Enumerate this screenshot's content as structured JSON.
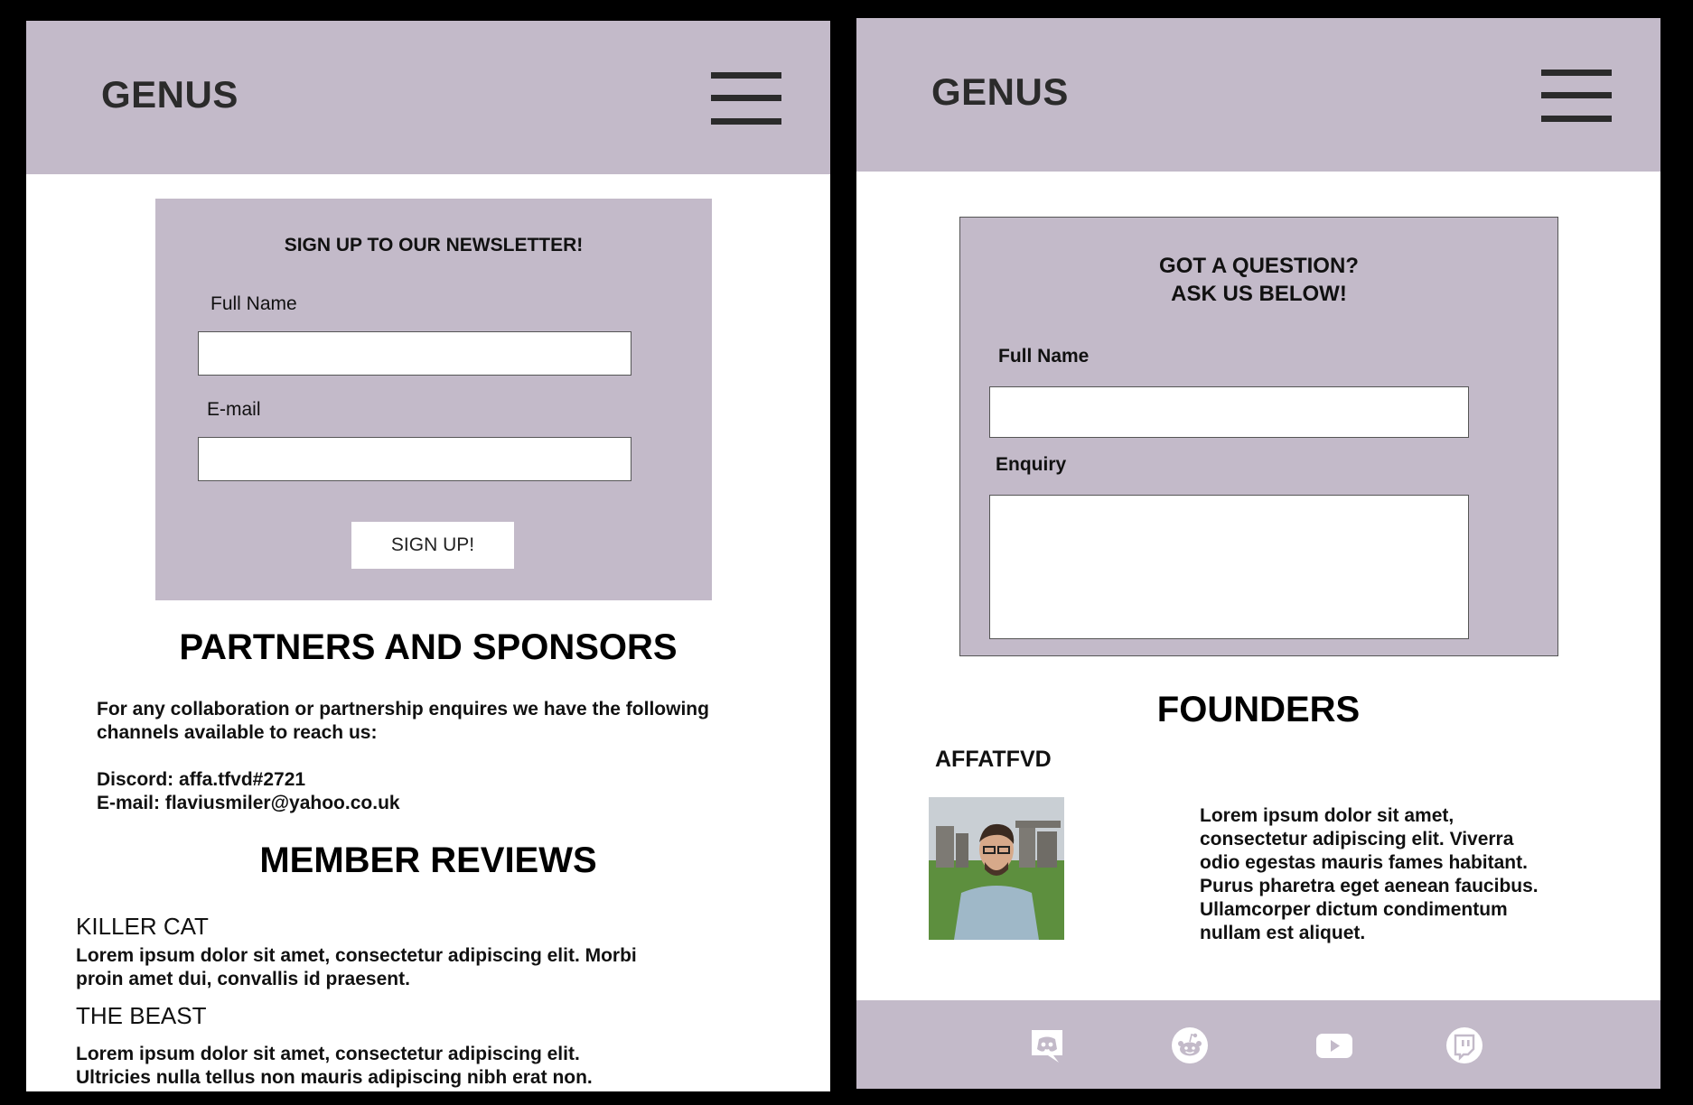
{
  "left": {
    "header": {
      "logo": "GENUS",
      "menu_icon": "hamburger-menu-icon"
    },
    "newsletter": {
      "title": "SIGN UP TO OUR  NEWSLETTER!",
      "name_label": "Full Name",
      "name_value": "",
      "email_label": "E-mail",
      "email_value": "",
      "button_label": "SIGN UP!"
    },
    "partners": {
      "title": "PARTNERS AND SPONSORS",
      "intro_line1": "For any collaboration or partnership enquires we have the following",
      "intro_line2": "channels available to reach us:",
      "discord": "Discord: affa.tfvd#2721",
      "email": "E-mail: flaviusmiler@yahoo.co.uk"
    },
    "reviews": {
      "title": "MEMBER REVIEWS",
      "items": [
        {
          "name": "KILLER CAT",
          "line1": "Lorem ipsum dolor sit amet, consectetur adipiscing elit. Morbi",
          "line2": "proin amet dui, convallis id praesent."
        },
        {
          "name": "THE BEAST",
          "line1": "Lorem ipsum dolor sit amet, consectetur adipiscing elit.",
          "line2": "Ultricies nulla tellus non mauris adipiscing nibh erat non."
        }
      ]
    }
  },
  "right": {
    "header": {
      "logo": "GENUS",
      "menu_icon": "hamburger-menu-icon"
    },
    "question": {
      "title_line1": "GOT A QUESTION?",
      "title_line2": "ASK US BELOW!",
      "name_label": "Full Name",
      "name_value": "",
      "enquiry_label": "Enquiry",
      "enquiry_value": ""
    },
    "founders": {
      "title": "FOUNDERS",
      "name": "AFFATFVD",
      "bio_lines": [
        "Lorem ipsum dolor sit amet,",
        "consectetur adipiscing elit. Viverra",
        "odio egestas mauris fames habitant.",
        "Purus pharetra eget aenean faucibus.",
        "Ullamcorper dictum condimentum",
        "nullam est aliquet."
      ]
    },
    "footer": {
      "icons": [
        "discord-icon",
        "reddit-icon",
        "youtube-icon",
        "twitch-icon"
      ]
    }
  },
  "colors": {
    "brand": "#c3bac9",
    "text": "#2b2b2b",
    "frame": "#000000"
  }
}
